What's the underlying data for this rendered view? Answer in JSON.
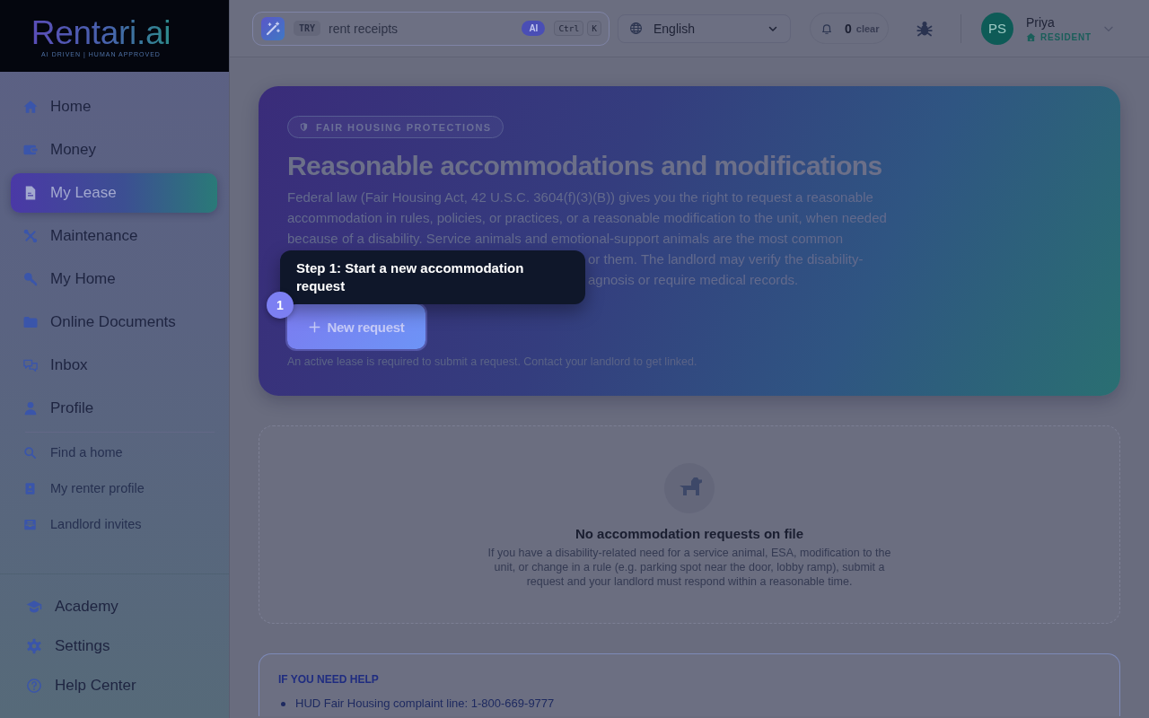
{
  "sidebar": {
    "logo": {
      "wordmark": "Rentari.ai",
      "tagline": "AI DRIVEN | HUMAN APPROVED"
    },
    "main_items": [
      {
        "label": "Home",
        "selected": false
      },
      {
        "label": "Money",
        "selected": false
      },
      {
        "label": "My Lease",
        "selected": true
      },
      {
        "label": "Maintenance",
        "selected": false
      },
      {
        "label": "My Home",
        "selected": false
      },
      {
        "label": "Online Documents",
        "selected": false
      },
      {
        "label": "Inbox",
        "selected": false
      },
      {
        "label": "Profile",
        "selected": false
      }
    ],
    "secondary_items": [
      {
        "label": "Find a home",
        "selected": false
      },
      {
        "label": "My renter profile",
        "selected": false
      },
      {
        "label": "Landlord invites",
        "selected": false
      }
    ],
    "footer_items": [
      {
        "label": "Academy",
        "selected": false
      },
      {
        "label": "Settings",
        "selected": false
      },
      {
        "label": "Help Center",
        "selected": false
      }
    ]
  },
  "top_bar": {
    "search": {
      "try_label": "TRY",
      "placeholder": "rent receipts",
      "ai_badge": "AI",
      "shortcut_keys": [
        "Ctrl",
        "K"
      ]
    },
    "language": {
      "value": "English"
    },
    "notifications": {
      "count": "0",
      "clear_label": "clear"
    },
    "user": {
      "initials": "PS",
      "name": "Priya",
      "role": "RESIDENT"
    }
  },
  "hero": {
    "tag": "FAIR HOUSING PROTECTIONS",
    "title": "Reasonable accommodations and modifications",
    "description_lines": [
      "Federal law (Fair Housing Act, 42 U.S.C. 3604(f)(3)(B)) gives you the right to request a reasonable",
      "accommodation in rules, policies, or practices, or a reasonable modification to the unit, when needed",
      "because of a disability. Service animals and emotional-support animals are the most common"
    ],
    "description_fragments": [
      "or them. The landlord may verify the disability-",
      "agnosis or require medical records."
    ],
    "new_request_button": "New request",
    "note": "An active lease is required to submit a request. Contact your landlord to get linked."
  },
  "tour": {
    "step": "1",
    "tooltip": "Step 1: Start a new accommodation request"
  },
  "empty_state": {
    "title": "No accommodation requests on file",
    "body": "If you have a disability-related need for a service animal, ESA, modification to the unit, or change in a rule (e.g. parking spot near the door, lobby ramp), submit a request and your landlord must respond within a reasonable time."
  },
  "help": {
    "title": "IF YOU NEED HELP",
    "items": [
      "HUD Fair Housing complaint line: 1-800-669-9777"
    ]
  }
}
